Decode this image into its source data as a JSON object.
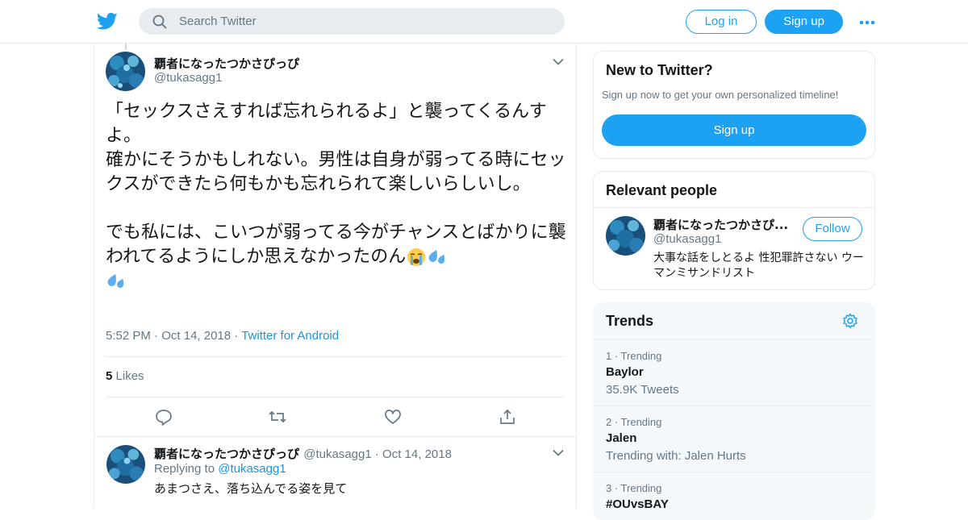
{
  "header": {
    "search_placeholder": "Search Twitter",
    "login_label": "Log in",
    "signup_label": "Sign up",
    "brand_color": "#1da1f2"
  },
  "tweet": {
    "author_name": "覇者になったつかさぴっぴ",
    "author_handle": "@tukasagg1",
    "text_1": "「セックスさえすれば忘れられるよ」と襲ってくるんすよ。\n確かにそうかもしれない。男性は自身が弱ってる時にセックスができたら何もかも忘れられて楽しいらしいし。\n\nでも私には、こいつが弱ってる今がチャンスとばかりに襲われてるようにしか思えなかったのん",
    "emojis": [
      "loudly-crying-face",
      "sweat-droplets",
      "sweat-droplets"
    ],
    "time": "5:52 PM",
    "date": "Oct 14, 2018",
    "source": "Twitter for Android",
    "likes_count": "5",
    "likes_label": "Likes",
    "actions": [
      "reply-icon",
      "retweet-icon",
      "like-icon",
      "share-icon"
    ]
  },
  "reply": {
    "author_name": "覇者になったつかさぴっぴ",
    "author_handle": "@tukasagg1",
    "date": "Oct 14, 2018",
    "replying_to_label": "Replying to",
    "replying_to_handle": "@tukasagg1",
    "text": "あまつさえ、落ち込んでる姿を見て"
  },
  "sidebar": {
    "new_to_twitter": {
      "title": "New to Twitter?",
      "subtitle": "Sign up now to get your own personalized timeline!",
      "signup_label": "Sign up"
    },
    "relevant_people": {
      "title": "Relevant people",
      "person": {
        "name": "覇者になったつかさぴ...",
        "handle": "@tukasagg1",
        "follow_label": "Follow",
        "bio": "大事な話をしとるよ 性犯罪許さない ウーマンミサンドリスト"
      }
    },
    "trends": {
      "title": "Trends",
      "items": [
        {
          "rank": "1 · Trending",
          "name": "Baylor",
          "sub": "35.9K Tweets"
        },
        {
          "rank": "2 · Trending",
          "name": "Jalen",
          "sub": "Trending with: Jalen Hurts"
        },
        {
          "rank": "3 · Trending",
          "name": "#OUvsBAY",
          "sub": ""
        }
      ]
    }
  }
}
